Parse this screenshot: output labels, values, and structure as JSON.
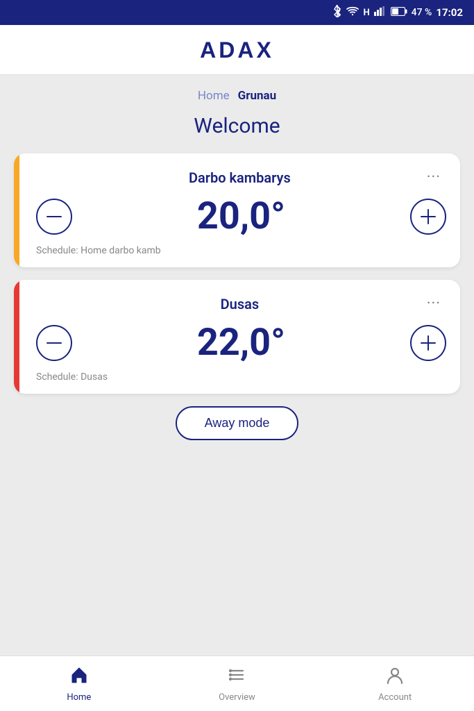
{
  "statusBar": {
    "battery": "47 %",
    "time": "17:02",
    "bluetooth": "BT",
    "wifi": "WiFi",
    "signal": "H"
  },
  "header": {
    "logo": "ADAX"
  },
  "breadcrumb": {
    "items": [
      {
        "label": "Home",
        "active": false
      },
      {
        "label": "Grunau",
        "active": true
      }
    ]
  },
  "welcome": {
    "title": "Welcome"
  },
  "devices": [
    {
      "name": "Darbo kambarys",
      "temperature": "20,0°",
      "schedule": "Schedule: Home darbo kamb",
      "indicator": "yellow"
    },
    {
      "name": "Dusas",
      "temperature": "22,0°",
      "schedule": "Schedule: Dusas",
      "indicator": "red"
    }
  ],
  "awayMode": {
    "label": "Away mode"
  },
  "bottomNav": {
    "items": [
      {
        "label": "Home",
        "active": true,
        "icon": "home"
      },
      {
        "label": "Overview",
        "active": false,
        "icon": "list"
      },
      {
        "label": "Account",
        "active": false,
        "icon": "person"
      }
    ]
  }
}
